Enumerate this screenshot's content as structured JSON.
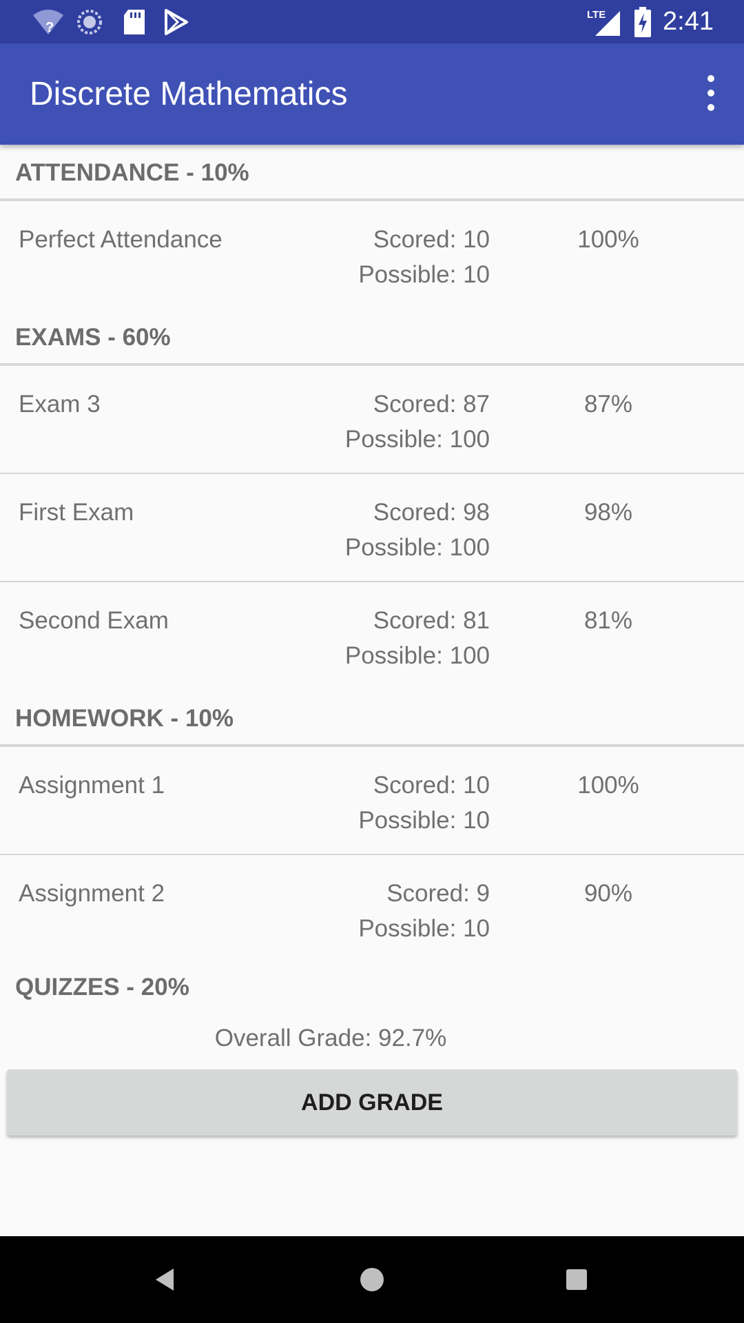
{
  "status_bar": {
    "time": "2:41",
    "icons": [
      "wifi-unknown-icon",
      "sync-icon",
      "sd-card-icon",
      "play-store-icon",
      "lte-signal-icon",
      "battery-charging-icon"
    ]
  },
  "app_bar": {
    "title": "Discrete Mathematics",
    "overflow_icon": "more-vert-icon"
  },
  "sections": [
    {
      "header": "ATTENDANCE - 10%",
      "items": [
        {
          "name": "Perfect Attendance",
          "scored": "Scored: 10",
          "possible": "Possible: 10",
          "percent": "100%"
        }
      ]
    },
    {
      "header": "EXAMS - 60%",
      "items": [
        {
          "name": "Exam 3",
          "scored": "Scored: 87",
          "possible": "Possible: 100",
          "percent": "87%"
        },
        {
          "name": "First Exam",
          "scored": "Scored: 98",
          "possible": "Possible: 100",
          "percent": "98%"
        },
        {
          "name": "Second Exam",
          "scored": "Scored: 81",
          "possible": "Possible: 100",
          "percent": "81%"
        }
      ]
    },
    {
      "header": "HOMEWORK - 10%",
      "items": [
        {
          "name": "Assignment 1",
          "scored": "Scored: 10",
          "possible": "Possible: 10",
          "percent": "100%"
        },
        {
          "name": "Assignment 2",
          "scored": "Scored: 9",
          "possible": "Possible: 10",
          "percent": "90%"
        }
      ]
    },
    {
      "header": "QUIZZES - 20%",
      "items": []
    }
  ],
  "overall_grade": "Overall Grade: 92.7%",
  "add_button_label": "ADD GRADE",
  "nav_bar": {
    "icons": [
      "back-icon",
      "home-icon",
      "recents-icon"
    ]
  },
  "colors": {
    "status_bar": "#303f9f",
    "app_bar": "#3f51b5",
    "background": "#fafafa",
    "button": "#d6d7d7"
  }
}
